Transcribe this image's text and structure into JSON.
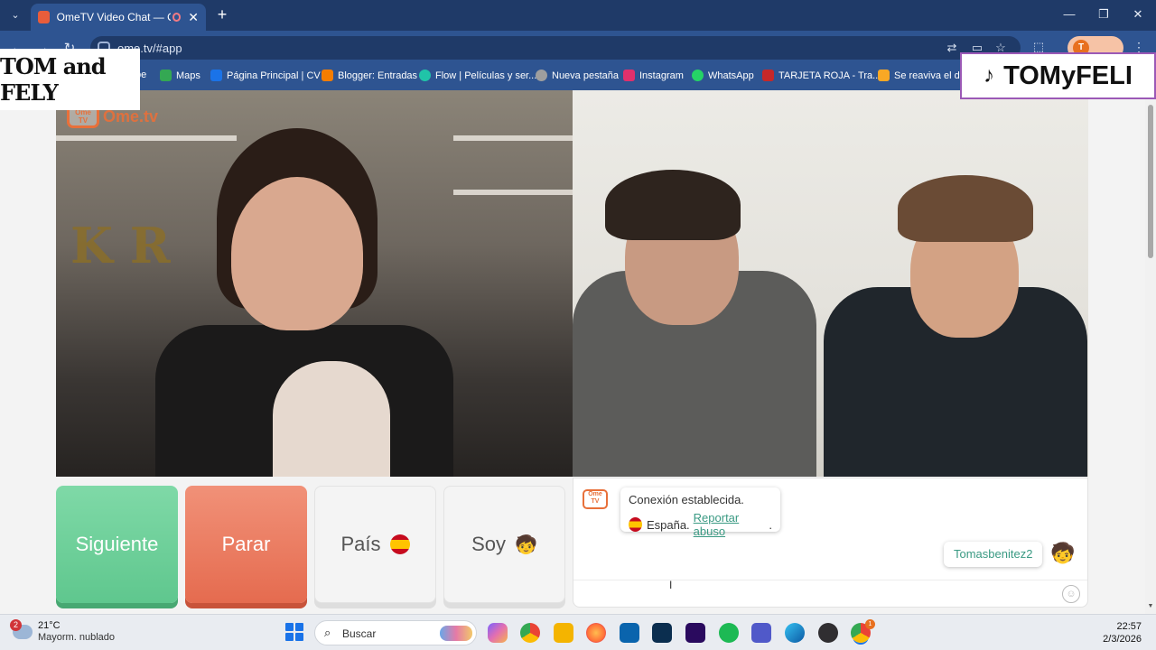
{
  "browser": {
    "tab_title": "OmeTV Video Chat — OmeTV",
    "tab_close": "✕",
    "tab_new": "+",
    "url": "ome.tv/#app",
    "profile_initial": "T",
    "window_controls": {
      "minimize": "—",
      "maximize": "❐",
      "close": "✕"
    }
  },
  "bookmarks": [
    {
      "label": "pe",
      "icon": "youtube-icon",
      "color": "#ff0000"
    },
    {
      "label": "Maps",
      "icon": "maps-icon",
      "color": "#34a853"
    },
    {
      "label": "Página Principal | CV",
      "icon": "cv-icon",
      "color": "#1a73e8"
    },
    {
      "label": "Blogger: Entradas",
      "icon": "blogger-icon",
      "color": "#f57d00"
    },
    {
      "label": "Flow | Películas y ser...",
      "icon": "flow-icon",
      "color": "#20c4a8"
    },
    {
      "label": "Nueva pestaña",
      "icon": "new-tab-icon",
      "color": "#9e9e9e"
    },
    {
      "label": "Instagram",
      "icon": "instagram-icon",
      "color": "#e1306c"
    },
    {
      "label": "WhatsApp",
      "icon": "whatsapp-icon",
      "color": "#25d366"
    },
    {
      "label": "TARJETA ROJA - Tra...",
      "icon": "tarjeta-roja-icon",
      "color": "#c62828"
    },
    {
      "label": "Se reaviva el deb",
      "icon": "news-icon",
      "color": "#f9a825"
    }
  ],
  "watermarks": {
    "left": "TOM and FELY",
    "right": "TOMyFELI"
  },
  "ometv": {
    "logo_icon_text": "Ome TV",
    "logo_word": "Ome.tv"
  },
  "controls": {
    "next": "Siguiente",
    "stop": "Parar",
    "country": "País",
    "gender": "Soy"
  },
  "chat": {
    "system_title": "Conexión establecida.",
    "system_country": "España.",
    "report_link": "Reportar abuso",
    "report_suffix": ".",
    "user_message": "Tomasbenitez2",
    "user_avatar": "🧒",
    "input_placeholder": "",
    "emoji_button": "☺"
  },
  "taskbar": {
    "weather_badge": "2",
    "temperature": "21°C",
    "weather_desc": "Mayorm. nublado",
    "search_label": "Buscar",
    "time": "22:57",
    "date": "2/3/2026",
    "chrome_badge": "1",
    "apps": [
      {
        "name": "copilot-icon",
        "color": "#7b61ff"
      },
      {
        "name": "chrome-icon",
        "color": "#ea4335"
      },
      {
        "name": "file-explorer-icon",
        "color": "#f4b400"
      },
      {
        "name": "firefox-icon",
        "color": "#ff7139"
      },
      {
        "name": "outlook-icon",
        "color": "#0a64ad"
      },
      {
        "name": "app-store-icon",
        "color": "#0b2e4f"
      },
      {
        "name": "premiere-icon",
        "color": "#2a0a5e"
      },
      {
        "name": "spotify-icon",
        "color": "#1db954"
      },
      {
        "name": "teams-icon",
        "color": "#5059c9"
      },
      {
        "name": "edge-icon",
        "color": "#0c8ed9"
      },
      {
        "name": "obs-icon",
        "color": "#302e31"
      },
      {
        "name": "chrome-active-icon",
        "color": "#4285f4"
      }
    ]
  }
}
